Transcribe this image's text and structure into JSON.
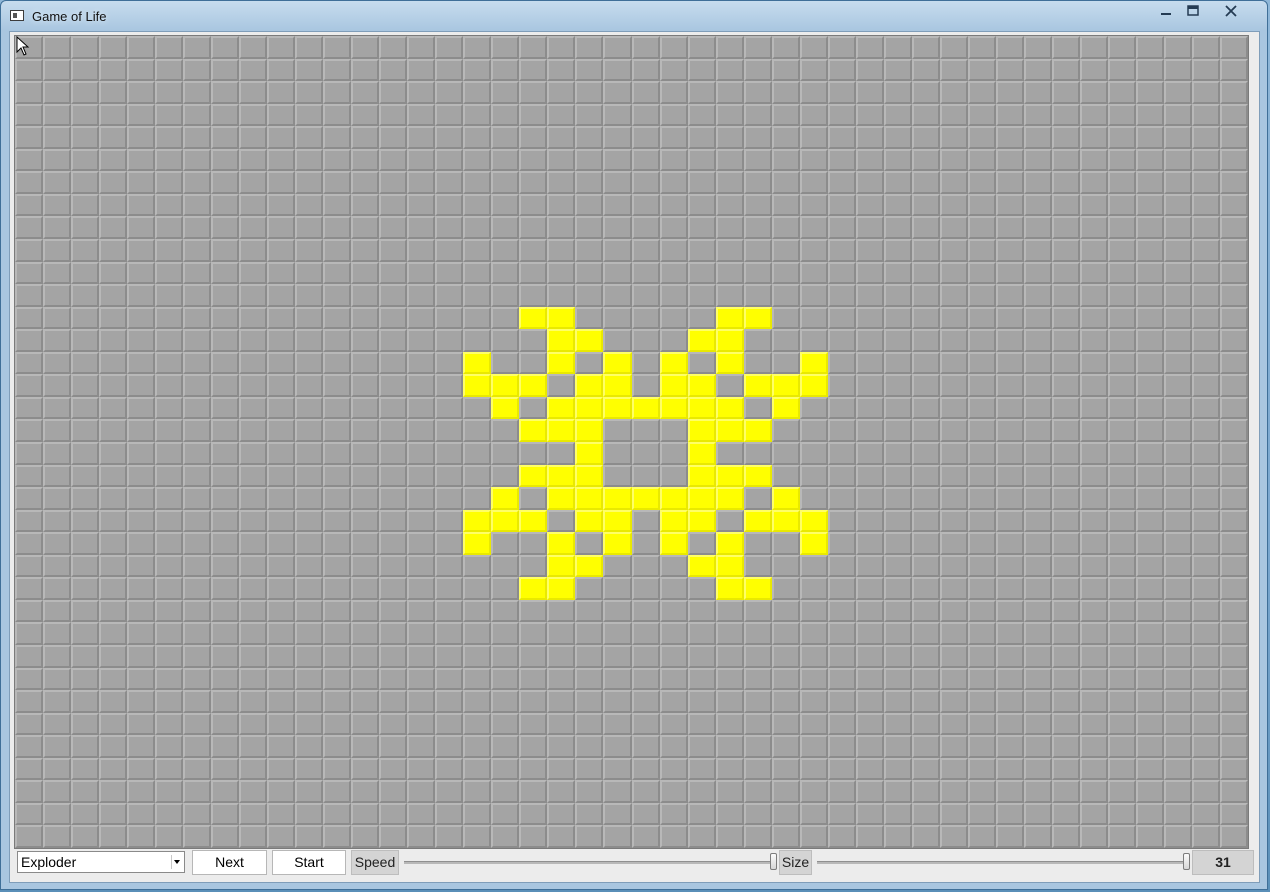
{
  "window": {
    "title": "Game of Life",
    "icon": "app-window-icon",
    "controls": {
      "minimize": "minimize-icon",
      "maximize": "maximize-icon",
      "close": "close-icon"
    }
  },
  "board": {
    "cols": 44,
    "rows": 36,
    "dead_color": "#a4a4a4",
    "alive_color": "#ffff00",
    "alive_cells": [
      [
        12,
        18
      ],
      [
        12,
        19
      ],
      [
        12,
        25
      ],
      [
        12,
        26
      ],
      [
        13,
        19
      ],
      [
        13,
        20
      ],
      [
        13,
        24
      ],
      [
        13,
        25
      ],
      [
        14,
        16
      ],
      [
        14,
        19
      ],
      [
        14,
        21
      ],
      [
        14,
        23
      ],
      [
        14,
        25
      ],
      [
        14,
        28
      ],
      [
        15,
        16
      ],
      [
        15,
        17
      ],
      [
        15,
        18
      ],
      [
        15,
        20
      ],
      [
        15,
        21
      ],
      [
        15,
        23
      ],
      [
        15,
        24
      ],
      [
        15,
        26
      ],
      [
        15,
        27
      ],
      [
        15,
        28
      ],
      [
        16,
        17
      ],
      [
        16,
        19
      ],
      [
        16,
        20
      ],
      [
        16,
        21
      ],
      [
        16,
        22
      ],
      [
        16,
        23
      ],
      [
        16,
        24
      ],
      [
        16,
        25
      ],
      [
        16,
        27
      ],
      [
        17,
        18
      ],
      [
        17,
        19
      ],
      [
        17,
        20
      ],
      [
        17,
        24
      ],
      [
        17,
        25
      ],
      [
        17,
        26
      ],
      [
        18,
        20
      ],
      [
        18,
        24
      ],
      [
        19,
        18
      ],
      [
        19,
        19
      ],
      [
        19,
        20
      ],
      [
        19,
        24
      ],
      [
        19,
        25
      ],
      [
        19,
        26
      ],
      [
        20,
        17
      ],
      [
        20,
        19
      ],
      [
        20,
        20
      ],
      [
        20,
        21
      ],
      [
        20,
        22
      ],
      [
        20,
        23
      ],
      [
        20,
        24
      ],
      [
        20,
        25
      ],
      [
        20,
        27
      ],
      [
        21,
        16
      ],
      [
        21,
        17
      ],
      [
        21,
        18
      ],
      [
        21,
        20
      ],
      [
        21,
        21
      ],
      [
        21,
        23
      ],
      [
        21,
        24
      ],
      [
        21,
        26
      ],
      [
        21,
        27
      ],
      [
        21,
        28
      ],
      [
        22,
        16
      ],
      [
        22,
        19
      ],
      [
        22,
        21
      ],
      [
        22,
        23
      ],
      [
        22,
        25
      ],
      [
        22,
        28
      ],
      [
        23,
        19
      ],
      [
        23,
        20
      ],
      [
        23,
        24
      ],
      [
        23,
        25
      ],
      [
        24,
        18
      ],
      [
        24,
        19
      ],
      [
        24,
        25
      ],
      [
        24,
        26
      ]
    ]
  },
  "toolbar": {
    "pattern_value": "Exploder",
    "next_label": "Next",
    "start_label": "Start",
    "speed_label": "Speed",
    "speed_value": 1.0,
    "size_label": "Size",
    "size_slider_value": 1.0,
    "size_value": "31"
  }
}
